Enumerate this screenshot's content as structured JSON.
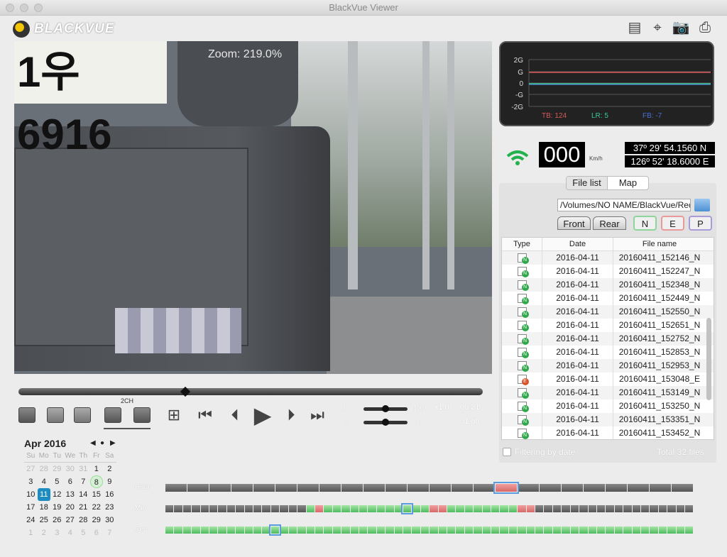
{
  "window": {
    "title": "BlackVue Viewer"
  },
  "logo": {
    "text": "BLACKVUE"
  },
  "toolbar": {
    "icons": [
      "sd-card-settings-icon",
      "gps-target-icon",
      "camera-capture-icon",
      "print-icon"
    ]
  },
  "video": {
    "zoom_label": "Zoom: 219.0%",
    "plate_text": "1우6916"
  },
  "gsensor": {
    "y_ticks": [
      "2G",
      "G",
      "0",
      "-G",
      "-2G"
    ],
    "tb_label": "TB: 124",
    "lr_label": "LR: 5",
    "fb_label": "FB: -7",
    "colors": {
      "tb": "#d85a5a",
      "lr": "#3ec79a",
      "fb": "#4a6fd0"
    }
  },
  "gps": {
    "speed": "000",
    "unit": "Km/h",
    "lat": "37º 29' 54.1560 N",
    "lon": "126º 52' 18.6000 E"
  },
  "tabs": [
    {
      "label": "File list",
      "active": true
    },
    {
      "label": "Map",
      "active": false
    }
  ],
  "files": {
    "path": "/Volumes/NO NAME/BlackVue/Record",
    "cam_tabs": [
      "Front",
      "Rear"
    ],
    "type_buttons": [
      {
        "label": "N",
        "color": "#8fd49a"
      },
      {
        "label": "E",
        "color": "#e89a9a"
      },
      {
        "label": "P",
        "color": "#a99ad8"
      }
    ],
    "columns": [
      "Type",
      "Date",
      "File name"
    ],
    "rows": [
      {
        "type": "N",
        "date": "2016-04-11",
        "name": "20160411_152146_N"
      },
      {
        "type": "N",
        "date": "2016-04-11",
        "name": "20160411_152247_N"
      },
      {
        "type": "N",
        "date": "2016-04-11",
        "name": "20160411_152348_N"
      },
      {
        "type": "N",
        "date": "2016-04-11",
        "name": "20160411_152449_N"
      },
      {
        "type": "N",
        "date": "2016-04-11",
        "name": "20160411_152550_N"
      },
      {
        "type": "N",
        "date": "2016-04-11",
        "name": "20160411_152651_N"
      },
      {
        "type": "N",
        "date": "2016-04-11",
        "name": "20160411_152752_N"
      },
      {
        "type": "N",
        "date": "2016-04-11",
        "name": "20160411_152853_N"
      },
      {
        "type": "N",
        "date": "2016-04-11",
        "name": "20160411_152953_N"
      },
      {
        "type": "E",
        "date": "2016-04-11",
        "name": "20160411_153048_E"
      },
      {
        "type": "N",
        "date": "2016-04-11",
        "name": "20160411_153149_N"
      },
      {
        "type": "N",
        "date": "2016-04-11",
        "name": "20160411_153250_N"
      },
      {
        "type": "N",
        "date": "2016-04-11",
        "name": "20160411_153351_N"
      },
      {
        "type": "N",
        "date": "2016-04-11",
        "name": "20160411_153452_N"
      }
    ],
    "filter_label": "Filtering by date",
    "filter_checked": false,
    "total": "Total 32 files"
  },
  "playback": {
    "progress_percent": 36,
    "channel_label": "2CH",
    "speed_value": "x1.0",
    "time": "00:21",
    "duration": "01:00",
    "volume_percent": 50,
    "brightness_percent": 50
  },
  "calendar": {
    "month": "Apr 2016",
    "weekdays": [
      "Su",
      "Mo",
      "Tu",
      "We",
      "Th",
      "Fr",
      "Sa"
    ],
    "days": [
      [
        "27",
        "o"
      ],
      [
        "28",
        "o"
      ],
      [
        "29",
        "o"
      ],
      [
        "30",
        "o"
      ],
      [
        "31",
        "o"
      ],
      [
        "1",
        ""
      ],
      [
        "2",
        ""
      ],
      [
        "3",
        ""
      ],
      [
        "4",
        ""
      ],
      [
        "5",
        ""
      ],
      [
        "6",
        ""
      ],
      [
        "7",
        ""
      ],
      [
        "8",
        "tod"
      ],
      [
        "9",
        ""
      ],
      [
        "10",
        ""
      ],
      [
        "11",
        "sel"
      ],
      [
        "12",
        ""
      ],
      [
        "13",
        ""
      ],
      [
        "14",
        ""
      ],
      [
        "15",
        ""
      ],
      [
        "16",
        ""
      ],
      [
        "17",
        ""
      ],
      [
        "18",
        ""
      ],
      [
        "19",
        ""
      ],
      [
        "20",
        ""
      ],
      [
        "21",
        ""
      ],
      [
        "22",
        ""
      ],
      [
        "23",
        ""
      ],
      [
        "24",
        ""
      ],
      [
        "25",
        ""
      ],
      [
        "26",
        ""
      ],
      [
        "27",
        ""
      ],
      [
        "28",
        ""
      ],
      [
        "29",
        ""
      ],
      [
        "30",
        ""
      ],
      [
        "1",
        "o"
      ],
      [
        "2",
        "o"
      ],
      [
        "3",
        "o"
      ],
      [
        "4",
        "o"
      ],
      [
        "5",
        "o"
      ],
      [
        "6",
        "o"
      ],
      [
        "7",
        "o"
      ]
    ]
  },
  "timeline": {
    "labels": [
      "Hour",
      "Min",
      "Sec"
    ],
    "hour": {
      "segments": 24,
      "event": [
        15
      ],
      "normal": [],
      "selected": 15
    },
    "min": {
      "segments": 60,
      "normal_range": [
        16,
        41
      ],
      "event": [
        17,
        30,
        31,
        40,
        41
      ],
      "selected": 27
    },
    "sec": {
      "segments": 60,
      "normal_range": [
        0,
        59
      ],
      "event": [],
      "selected": 12
    }
  }
}
